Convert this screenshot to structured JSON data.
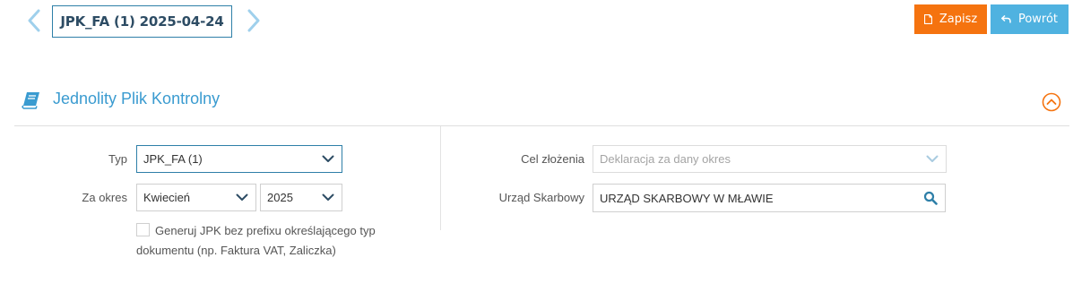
{
  "nav": {
    "document_title": "JPK_FA (1) 2025-04-24",
    "prev_icon": "chevron-left-icon",
    "next_icon": "chevron-right-icon"
  },
  "toolbar": {
    "save_label": "Zapisz",
    "save_icon": "document-icon",
    "back_label": "Powrót",
    "back_icon": "reply-arrow-icon"
  },
  "section": {
    "title": "Jednolity Plik Kontrolny",
    "icon": "book-icon",
    "collapse_icon": "chevron-up-circle-icon"
  },
  "form": {
    "typ_label": "Typ",
    "typ_value": "JPK_FA (1)",
    "okres_label": "Za okres",
    "month_value": "Kwiecień",
    "year_value": "2025",
    "checkbox_label": "Generuj JPK bez prefixu określającego typ dokumentu (np. Faktura VAT, Zaliczka)",
    "checkbox_checked": false,
    "cel_label": "Cel złożenia",
    "cel_value": "Deklaracja za dany okres",
    "urzad_label": "Urząd Skarbowy",
    "urzad_value": "URZĄD SKARBOWY W MŁAWIE"
  },
  "colors": {
    "accent_blue": "#3a9bd0",
    "title_border": "#2e7fa8",
    "save_orange": "#f5730f",
    "back_blue": "#4fb2e0",
    "collapse_orange": "#f5730f"
  }
}
